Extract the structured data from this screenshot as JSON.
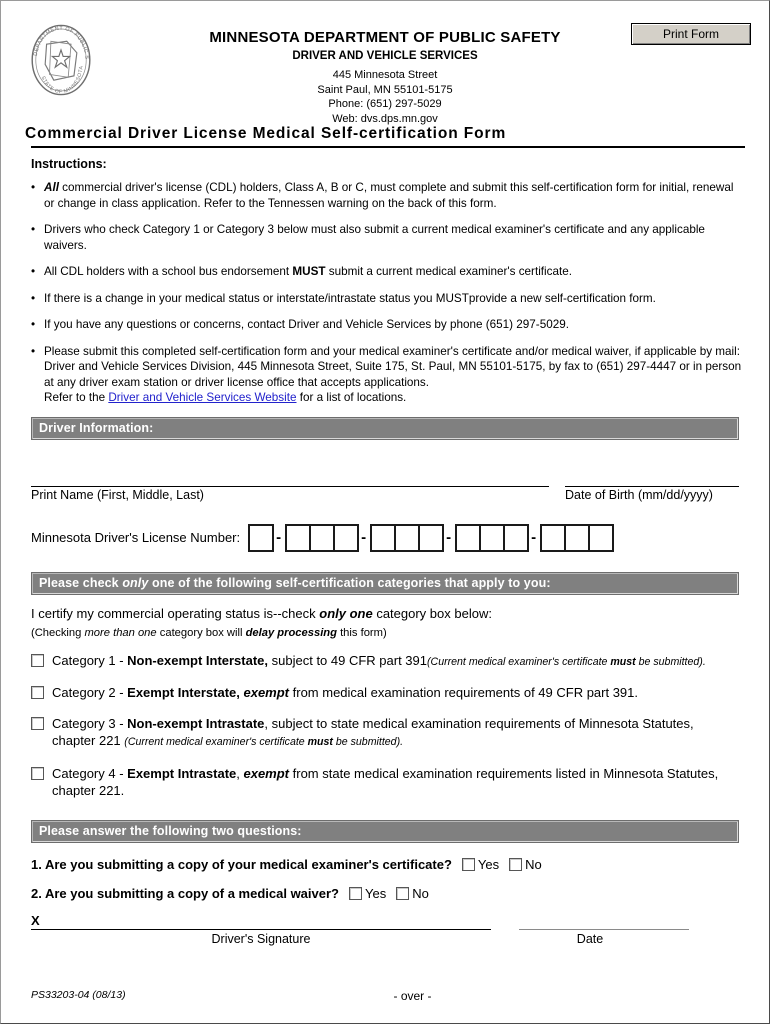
{
  "header": {
    "print_button": "Print Form",
    "department": "MINNESOTA  DEPARTMENT OF PUBLIC SAFETY",
    "division": "DRIVER AND VEHICLE SERVICES",
    "address_street": "445 Minnesota Street",
    "address_city": "Saint Paul, MN 55101-5175",
    "phone": "Phone: (651) 297-5029",
    "web": "Web: dvs.dps.mn.gov",
    "seal_outer_top_text": "DEPARTMENT OF PUBLIC SAFETY",
    "seal_outer_bottom_text": "STATE OF MINNESOTA"
  },
  "form_title": "Commercial Driver License Medical Self-certification Form",
  "instructions": {
    "heading": "Instructions:",
    "bullet_marker": "•",
    "items": [
      {
        "lead_bold_italic": "All",
        "rest": " commercial driver's license (CDL) holders, Class A, B or C, must complete and submit this self-certification form for initial, renewal or change in class application. Refer to the Tennessen warning on the back of this form."
      },
      {
        "text": "Drivers who check Category 1 or Category 3 below must also submit a current medical examiner's certificate and any applicable waivers."
      },
      {
        "pre": "All CDL holders with a school bus endorsement ",
        "bold": "MUST",
        "post": " submit a current medical examiner's certificate."
      },
      {
        "text": "If there is a change in your medical status or interstate/intrastate status you MUSTprovide a new self-certification form."
      },
      {
        "text": "If you have any questions or concerns, contact Driver and Vehicle Services by phone (651) 297-5029."
      },
      {
        "text": "Please submit this completed self-certification form and your medical examiner's certificate and/or medical waiver, if applicable by mail: Driver and Vehicle Services Division, 445 Minnesota Street, Suite 175, St. Paul, MN 55101-5175, by fax to (651) 297-4447 or in person at any driver exam station or driver license office that accepts applications.",
        "refer_pre": "Refer to the ",
        "link_text": "Driver and Vehicle Services Website",
        "refer_post": " for a list of locations."
      }
    ]
  },
  "driver_information": {
    "bar_label": "Driver Information:",
    "name_label": "Print Name (First, Middle, Last)",
    "dob_label": "Date of Birth (mm/dd/yyyy)",
    "name_value": "",
    "dob_value": "",
    "license_label": "Minnesota Driver's License Number:",
    "license_separator": "-",
    "license_group_sizes": [
      1,
      3,
      3,
      3,
      3
    ]
  },
  "categories_section": {
    "bar_pre": "Please check ",
    "bar_italic": "only",
    "bar_post": " one of the following self-certification categories that apply to you:",
    "certify_pre": "I certify my commercial operating status is--check ",
    "certify_bold_italic": "only one",
    "certify_post": " category box below:",
    "note_pre": "(Checking ",
    "note_italic1": "more than one",
    "note_mid": " category box will ",
    "note_bolditalic": "delay processing",
    "note_post": " this form)",
    "items": [
      {
        "prefix": "Category 1 - ",
        "bold": "Non-exempt Interstate,",
        "mid": " subject to 49 CFR part 391",
        "paren_pre": "(",
        "paren_italic_1": "Current medical examiner's certificate ",
        "paren_bold": "must",
        "paren_italic_2": " be submitted",
        "paren_post": ").",
        "checked": false
      },
      {
        "prefix": "Category 2 - ",
        "bold": "Exempt Interstate, ",
        "bold_italic": "exempt",
        "mid": " from medical examination requirements of 49 CFR part 391.",
        "checked": false
      },
      {
        "prefix": "Category 3 - ",
        "bold": "Non-exempt Intrastate",
        "mid": ", subject to state medical examination requirements of Minnesota Statutes, chapter 221 ",
        "paren_pre": "(",
        "paren_italic_1": "Current medical examiner's certificate ",
        "paren_bold": "must",
        "paren_italic_2": " be submitted",
        "paren_post": ").",
        "checked": false
      },
      {
        "prefix": "Category 4 - ",
        "bold": "Exempt Intrastate",
        "mid_a": ", ",
        "bold_italic": "exempt",
        "mid": " from state medical examination requirements listed in Minnesota Statutes, chapter 221.",
        "checked": false
      }
    ]
  },
  "questions_section": {
    "bar_label": "Please answer the following two questions:",
    "questions": [
      {
        "text": "1. Are you submitting a copy of your medical examiner's certificate?",
        "yes_label": "Yes",
        "no_label": "No",
        "yes_checked": false,
        "no_checked": false
      },
      {
        "text": "2. Are you submitting a copy of a medical waiver?",
        "yes_label": "Yes",
        "no_label": "No",
        "yes_checked": false,
        "no_checked": false
      }
    ]
  },
  "signature_section": {
    "x_mark": "X",
    "signature_label": "Driver's Signature",
    "date_label": "Date",
    "signature_value": "",
    "date_value": ""
  },
  "footer": {
    "form_code": "PS33203-04 (08/13)",
    "over": "- over -"
  },
  "colors": {
    "bar_background": "#808080",
    "bar_text": "#ffffff",
    "link": "#2222cc",
    "button_face": "#d4d0c8",
    "page_background": "#ffffff"
  }
}
